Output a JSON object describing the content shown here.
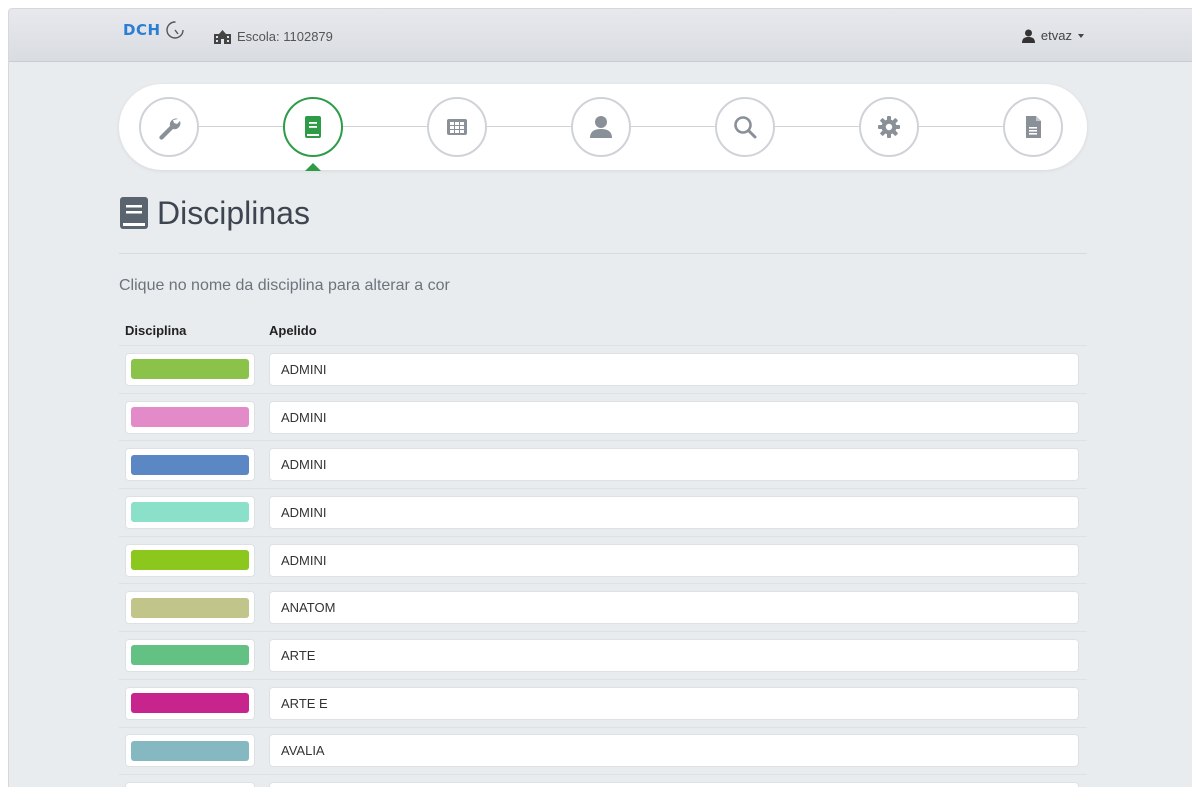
{
  "header": {
    "brand": "DCH",
    "school_label": "Escola: 1102879",
    "user_name": "etvaz"
  },
  "stepper": {
    "steps": [
      {
        "icon": "wrench-icon",
        "active": false
      },
      {
        "icon": "book-icon",
        "active": true
      },
      {
        "icon": "grid-icon",
        "active": false
      },
      {
        "icon": "user-icon",
        "active": false
      },
      {
        "icon": "search-icon",
        "active": false
      },
      {
        "icon": "gear-icon",
        "active": false
      },
      {
        "icon": "document-icon",
        "active": false
      }
    ],
    "active_color": "#2e9b47"
  },
  "page": {
    "title": "Disciplinas",
    "hint": "Clique no nome da disciplina para alterar a cor"
  },
  "table": {
    "columns": [
      "Disciplina",
      "Apelido"
    ],
    "rows": [
      {
        "color": "#8bc34a",
        "alias": "ADMINI"
      },
      {
        "color": "#e38bc8",
        "alias": "ADMINI"
      },
      {
        "color": "#5b87c4",
        "alias": "ADMINI"
      },
      {
        "color": "#8ae0c8",
        "alias": "ADMINI"
      },
      {
        "color": "#8cc71e",
        "alias": "ADMINI"
      },
      {
        "color": "#c2c58a",
        "alias": "ANATOM"
      },
      {
        "color": "#63c184",
        "alias": "ARTE"
      },
      {
        "color": "#c7248e",
        "alias": "ARTE E"
      },
      {
        "color": "#86b8c1",
        "alias": "AVALIA"
      },
      {
        "color": "#ffffff",
        "alias": ""
      }
    ]
  }
}
